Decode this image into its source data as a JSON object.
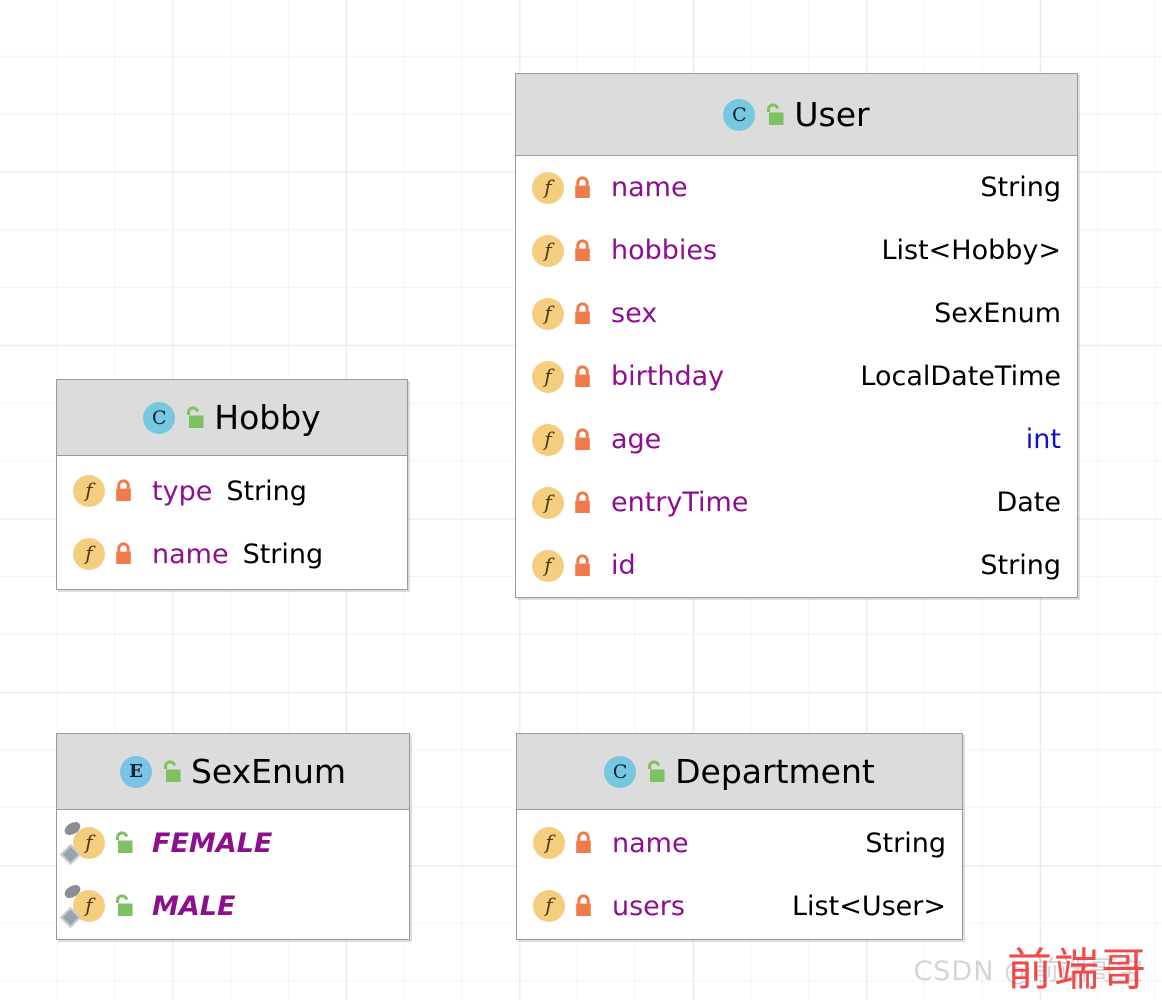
{
  "canvas": {
    "grid_minor_color": "#f4f4f4",
    "grid_major_color": "#e9e9e9",
    "background": "#ffffff"
  },
  "palette": {
    "class_icon_bg": "#76c7e0",
    "enum_icon_bg": "#79c3e8",
    "field_icon_bg": "#f5cd7f",
    "lock_private": "#ef7a4a",
    "lock_public": "#7dc162",
    "field_name": "#8e0f8e",
    "field_type": "#000000",
    "primitive_type": "#1111cc",
    "header_bg": "#dcdcdc",
    "border": "#9a9a9a"
  },
  "classes": [
    {
      "id": "user",
      "name": "User",
      "kind": "class",
      "kind_glyph": "C",
      "visibility": "public",
      "fields": [
        {
          "name": "name",
          "type": "String",
          "visibility": "private",
          "primitive": false,
          "static_final": false
        },
        {
          "name": "hobbies",
          "type": "List<Hobby>",
          "visibility": "private",
          "primitive": false,
          "static_final": false
        },
        {
          "name": "sex",
          "type": "SexEnum",
          "visibility": "private",
          "primitive": false,
          "static_final": false
        },
        {
          "name": "birthday",
          "type": "LocalDateTime",
          "visibility": "private",
          "primitive": false,
          "static_final": false
        },
        {
          "name": "age",
          "type": "int",
          "visibility": "private",
          "primitive": true,
          "static_final": false
        },
        {
          "name": "entryTime",
          "type": "Date",
          "visibility": "private",
          "primitive": false,
          "static_final": false
        },
        {
          "name": "id",
          "type": "String",
          "visibility": "private",
          "primitive": false,
          "static_final": false
        }
      ]
    },
    {
      "id": "hobby",
      "name": "Hobby",
      "kind": "class",
      "kind_glyph": "C",
      "visibility": "public",
      "fields": [
        {
          "name": "type",
          "type": "String",
          "visibility": "private",
          "primitive": false,
          "static_final": false
        },
        {
          "name": "name",
          "type": "String",
          "visibility": "private",
          "primitive": false,
          "static_final": false
        }
      ]
    },
    {
      "id": "sexenum",
      "name": "SexEnum",
      "kind": "enum",
      "kind_glyph": "E",
      "visibility": "public",
      "fields": [
        {
          "name": "FEMALE",
          "type": "",
          "visibility": "public",
          "primitive": false,
          "static_final": true
        },
        {
          "name": "MALE",
          "type": "",
          "visibility": "public",
          "primitive": false,
          "static_final": true
        }
      ]
    },
    {
      "id": "department",
      "name": "Department",
      "kind": "class",
      "kind_glyph": "C",
      "visibility": "public",
      "fields": [
        {
          "name": "name",
          "type": "String",
          "visibility": "private",
          "primitive": false,
          "static_final": false
        },
        {
          "name": "users",
          "type": "List<User>",
          "visibility": "private",
          "primitive": false,
          "static_final": false
        }
      ]
    }
  ],
  "watermarks": {
    "primary": "前端哥",
    "secondary": "CSDN @前端哥宝"
  },
  "icon_names": {
    "class": "class-icon",
    "enum": "enum-icon",
    "field": "field-icon",
    "lock_private": "lock-closed-icon",
    "lock_public": "lock-open-icon",
    "static_badge": "static-badge-icon",
    "final_badge": "final-badge-icon"
  }
}
